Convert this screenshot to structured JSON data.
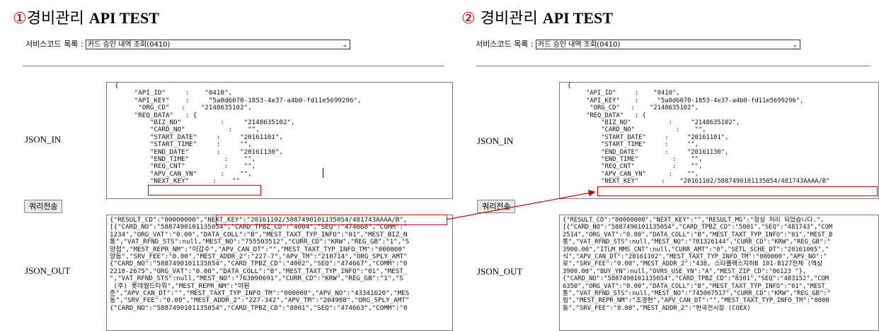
{
  "panel1": {
    "num": "①",
    "title_ko": "경비관리 ",
    "title_en": "API TEST",
    "service_label": "서비스코드 목록 :",
    "service_value": "카드 승인 내역 조회(0410)",
    "json_in_label": "JSON_IN",
    "json_out_label": "JSON_OUT",
    "query_button": "쿼리전송",
    "json_in": [
      "  {",
      "       \"API_ID\"     :    \"0410\",",
      "       \"API_KEY\"    :     \"5a0d6070-1853-4e37-a4b0-fd11e5699296\",",
      "        \"ORG_CD\"   :    \"2148635102\",",
      "       \"REQ_DATA\"   : {",
      "           \"BIZ_NO\"          :     \"2148635102\",",
      "           \"CARD_NO\"           :    \"\",",
      "           \"START_DATE\"     :     \"20161101\",",
      "           \"START_TIME\"     :     \"\",",
      "           \"END_DATE\"       :     \"20161130\",",
      "           \"END_TIME\"         :    \"\",",
      "           \"REQ_CNT\"          :    \"\",",
      "           \"APV_CAN_YN\"      :    \"\",",
      "           \"NEXT_KEY\"      :    \"\""
    ],
    "json_out": [
      "{\"RESULT_CD\":\"00000000\",\"NEXT_KEY\":\"20161102/5887490101135054/481743AAAA/B\",",
      "[{\"CARD_NO\":\"5887490101135054\",\"CARD_TPBZ_CD\":\"4004\",\"SEQ\":\"474668\",\"COMM\":\"",
      "1234\",\"ORG_VAT\":\"0.00\",\"DATA_COLL\":\"B\",\"MEST_TAXT_TYP_INFO\":\"01\",\"MEST_BIZ_N",
      "통\",\"VAT_RFND_STS\":null,\"MEST_NO\":\"755503512\",\"CURR_CD\":\"KRW\",\"REG_GB\":\"1\",\"S",
      "양점\",\"MEST_REPR_NM\":\"이갑수\",\"APV_CAN_DT\":\"\",\"MEST_TAXT_TYP_INFO_TM\":\"000000\"",
      "양동\",\"SRV_FEE\":\"0.00\",\"MEST_ADDR_2\":\"227-7\",\"APV_TM\":\"210714\",\"ORG_SPLY_AMT\"",
      "{\"CARD_NO\":\"5887490101135054\",\"CARD_TPBZ_CD\":\"4002\",\"SEQ\":\"474667\",\"COMM\":\"0",
      "2218-2675\",\"ORG_VAT\":\"0.00\",\"DATA_COLL\":\"B\",\"MEST_TAXT_TYP_INFO\":\"01\",\"MEST_",
      "\",\"VAT_RFND_STS\":null,\"MEST_NO\":\"763090691\",\"CURR_CD\":\"KRW\",\"REG_GB\":\"1\",\"S",
      " (주) 롯데월드타워\",\"MEST_REPR_NM\":\"이원",
      "준\",\"APV_CAN_DT\":\"\",\"MEST_TAXT_TYP_INFO_TM\":\"000000\",\"APV_NO\":\"43341620\",\"MES",
      "동\",\"SRV_FEE\":\"0.00\",\"MEST_ADDR_2\":\"227-342\",\"APV_TM\":\"204908\",\"ORG_SPLY_AMT\"",
      "{\"CARD_NO\":\"5887490101135054\",\"CARD_TPBZ_CD\":\"8001\",\"SEQ\":\"474663\",\"COMM\":\"0"
    ]
  },
  "panel2": {
    "num": "②",
    "title_ko": " 경비관리 ",
    "title_en": "API TEST",
    "service_label": "서비스코드 목록 :",
    "service_value": "카드 승인 내역 조회(0410)",
    "json_in_label": "JSON_IN",
    "json_out_label": "JSON_OUT",
    "query_button": "쿼리전송",
    "json_in": [
      "  {",
      "       \"API_ID\"     :    \"0410\",",
      "       \"API_KEY\"    :     \"5a0d6070-1853-4e37-a4b0-fd11e5699296\",",
      "        \"ORG_CD\"   :    \"2148635102\",",
      "       \"REQ_DATA\"   : {",
      "           \"BIZ_NO\"          :     \"2148635102\",",
      "           \"CARD_NO\"           :    \"\",",
      "           \"START_DATE\"     :     \"20161101\",",
      "           \"START_TIME\"     :     \"\",",
      "           \"END_DATE\"       :     \"20161130\",",
      "           \"END_TIME\"         :    \"\",",
      "           \"REQ_CNT\"          :    \"\",",
      "           \"APV_CAN_YN\"      :    \"\",",
      "           \"NEXT_KEY\"      :    \"20161102/5887490101135054/481743AAAA/B\""
    ],
    "json_out": [
      "{\"RESULT_CD\":\"00000000\",\"NEXT_KEY\":\"\",\"RESULT_MG\":\"정상 처리 되었습니다.\",",
      "[{\"CARD_NO\":\"5887490101135054\",\"CARD_TPBZ_CD\":\"5001\",\"SEQ\":\"481743\",\"COM",
      "2514\",\"ORG_VAT\":\"0.00\",\"DATA_COLL\":\"B\",\"MEST_TAXT_TYP_INFO\":\"01\",\"MEST_B",
      "통\",\"VAT_RFND_STS\":null,\"MEST_NO\":\"781326144\",\"CURR_CD\":\"KRW\",\"REG_GB\":\"",
      "3900.00\",\"ITLM_MMS_CNT\":null,\"CURR_AMT\":\"0\",\"SETL_SCHE_DT\":\"20161005\",\"",
      "식\",\"APV_CAN_DT\":\"20161102\",\"MEST_TAXT_TYP_INFO_TM\":\"000000\",\"APV_NO\":\"",
      "로\",\"SRV_FEE\":\"0.00\",\"MEST_ADDR_2\":\"438, 스타플렉스지하B 101-B127전체 (역삼",
      "3900.00\",\"BUY_YN\":null,\"OVRS_USE_YN\":\"A\",\"MEST_ZIP_CD\":\"06123 \"},",
      "{\"CARD_NO\":\"5887490101135054\",\"CARD_TPBZ_CD\":\"8301\",\"SEQ\":\"483152\",\"COM",
      "6350\",\"ORG_VAT\":\"0.00\",\"DATA_COLL\":\"B\",\"MEST_TAXT_TYP_INFO\":\"01\",\"MEST_",
      "통\",\"VAT_RFND_STS\":null,\"MEST_NO\":\"745007517\",\"CURR_CD\":\"KRW\",\"REG_GB\":\"",
      "림\",\"MEST_REPR_NM\":\"조경현\",\"APV_CAN_DT\":\"\",\"MEST_TAXT_TYP_INFO_TM\":\"0000",
      "동\",\"SRV_FEE\":\"0.00\",\"MEST_ADDR_2\":\"한국전시장 (COEX)"
    ]
  },
  "colors": {
    "highlight": "#d40000",
    "title_number": "#c00000"
  }
}
